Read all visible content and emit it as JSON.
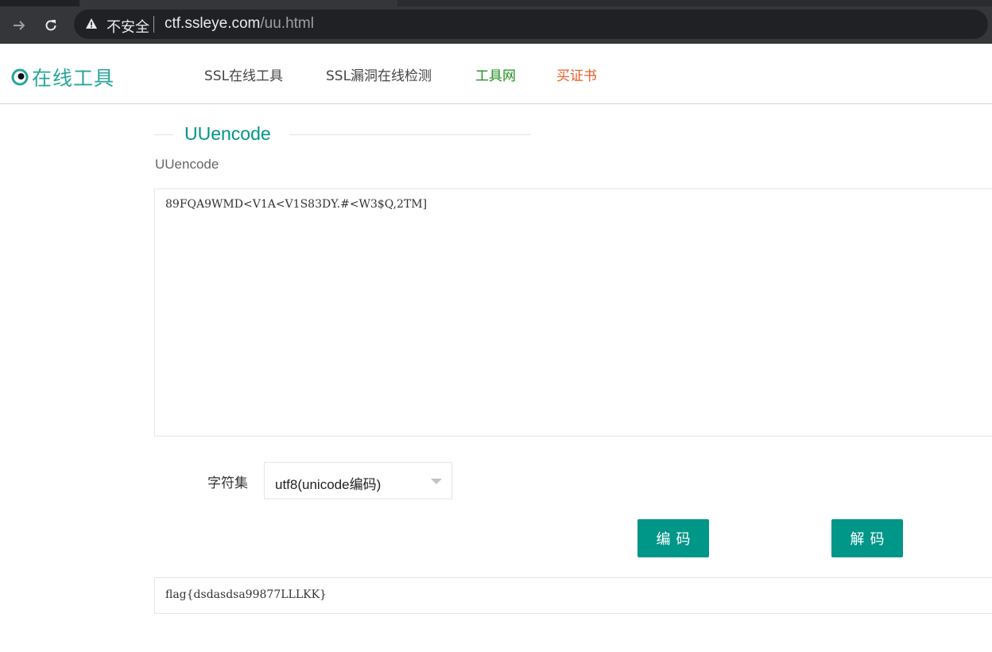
{
  "browser": {
    "security_label": "不安全",
    "url_host": "ctf.ssleye.com",
    "url_path": "/uu.html"
  },
  "site": {
    "logo_text": "在线工具",
    "nav": [
      {
        "label": "SSL在线工具",
        "color": "#444444"
      },
      {
        "label": "SSL漏洞在线检测",
        "color": "#444444"
      },
      {
        "label": "工具网",
        "color": "#1e8f1e"
      },
      {
        "label": "买证书",
        "color": "#ee5a24"
      }
    ]
  },
  "main": {
    "title": "UUencode",
    "field_label": "UUencode",
    "input_value": "89FQA9WMD<V1A<V1S83DY.#<W3$Q,2TM]",
    "charset_label": "字符集",
    "charset_value": "utf8(unicode编码)",
    "encode_label": "编码",
    "decode_label": "解码",
    "output_value": "flag{dsdasdsa99877LLLKK}"
  },
  "colors": {
    "accent": "#009688",
    "logo": "#26a69a"
  }
}
